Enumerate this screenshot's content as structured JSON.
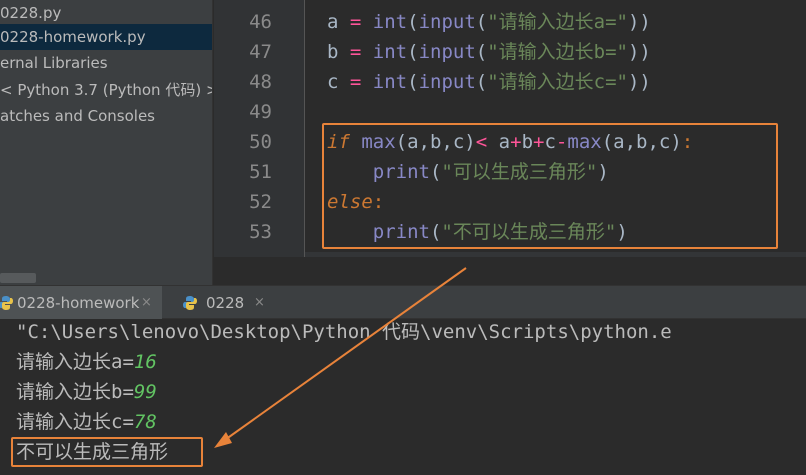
{
  "project_tree": {
    "items": [
      {
        "label": "0228.py",
        "selected": false
      },
      {
        "label": "0228-homework.py",
        "selected": true
      },
      {
        "label": "ernal Libraries",
        "selected": false
      },
      {
        "label": "< Python 3.7 (Python 代码) >",
        "chevron": "〈",
        "selected": false
      },
      {
        "label": "atches and Consoles",
        "selected": false
      }
    ]
  },
  "editor": {
    "line_numbers": [
      "46",
      "47",
      "48",
      "49",
      "50",
      "51",
      "52",
      "53"
    ],
    "code": {
      "l46": {
        "var": "a",
        "eq": " = ",
        "fn1": "int",
        "p1": "(",
        "fn2": "input",
        "p2": "(",
        "str": "\"请输入边长a=\"",
        "close": "))"
      },
      "l47": {
        "var": "b",
        "eq": " = ",
        "fn1": "int",
        "p1": "(",
        "fn2": "input",
        "p2": "(",
        "str": "\"请输入边长b=\"",
        "close": "))"
      },
      "l48": {
        "var": "c",
        "eq": " = ",
        "fn1": "int",
        "p1": "(",
        "fn2": "input",
        "p2": "(",
        "str": "\"请输入边长c=\"",
        "close": "))"
      },
      "l50": {
        "kw": "if",
        "sp": " ",
        "fn1": "max",
        "args1": "(a,b,c)",
        "lt": "<",
        "sp2": " ",
        "a": "a",
        "plus1": "+",
        "b": "b",
        "plus2": "+",
        "c": "c",
        "minus": "-",
        "fn2": "max",
        "args2": "(a,b,c)",
        "colon": ":"
      },
      "l51": {
        "indent": "    ",
        "fn": "print",
        "p": "(",
        "str": "\"可以生成三角形\"",
        "close": ")"
      },
      "l52": {
        "kw": "else",
        "colon": ":"
      },
      "l53": {
        "indent": "    ",
        "fn": "print",
        "p": "(",
        "str": "\"不可以生成三角形\"",
        "close": ")"
      }
    }
  },
  "run_tabs": [
    {
      "label": "0228-homework",
      "close": "×",
      "active": true
    },
    {
      "label": "0228",
      "close": "×",
      "active": false
    }
  ],
  "console": {
    "command": "\"C:\\Users\\lenovo\\Desktop\\Python 代码\\venv\\Scripts\\python.e",
    "prompts": [
      {
        "prompt": "请输入边长a=",
        "value": "16"
      },
      {
        "prompt": "请输入边长b=",
        "value": "99"
      },
      {
        "prompt": "请输入边长c=",
        "value": "78"
      }
    ],
    "result": "不可以生成三角形"
  },
  "colors": {
    "annotation": "#e8833a",
    "keyword": "#cc7832",
    "string": "#6a8759",
    "builtin": "#8888c6",
    "operator": "#ff5599",
    "console_input": "#62c463"
  }
}
